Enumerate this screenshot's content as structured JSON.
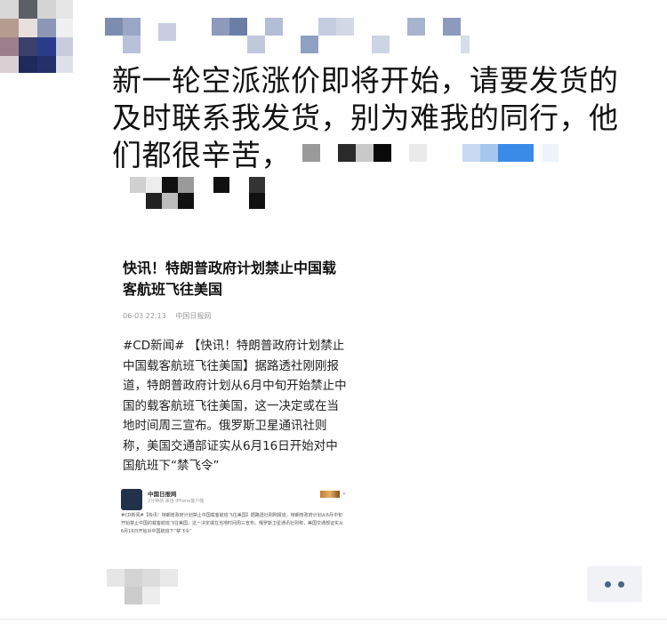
{
  "post": {
    "text_lines": [
      "新一轮空派涨价即将开始，请要发货的",
      "及时联系我发货，别为难我的同行，他",
      "们都很辛苦，"
    ]
  },
  "card": {
    "title": "快讯！特朗普政府计划禁止中国载客航班飞往美国",
    "meta_time": "06-03 22:13",
    "meta_source": "中国日报网",
    "body": "#CD新闻# 【快讯！特朗普政府计划禁止中国载客航班飞往美国】据路透社刚刚报道，特朗普政府计划从6月中旬开始禁止中国的载客航班飞往美国，这一决定或在当地时间周三宣布。俄罗斯卫星通讯社则称，美国交通部证实从6月16日开始对中国航班下“禁飞令”",
    "embed": {
      "name": "中国日报网",
      "sub": "2分钟前 来自 iPhone客户端",
      "body": "#CD新闻#【快讯！特朗普政府计划禁止中国载客航班飞往美国】据路透社刚刚报道，特朗普政府计划从6月中旬开始禁止中国的载客航班飞往美国，这一决定或在当地时间周三宣布。俄罗斯卫星通讯社则称，美国交通部证实从6月16日开始对中国航班下“禁飞令”"
    }
  },
  "icons": {
    "more": "more-dots-icon",
    "avatar": "avatar-pixelated",
    "embed_chevron": "chevron-down-icon"
  },
  "colors": {
    "link_blur": "#3a8be8",
    "more_button_bg": "#f0f2f5",
    "dot_color": "#4a6585"
  }
}
